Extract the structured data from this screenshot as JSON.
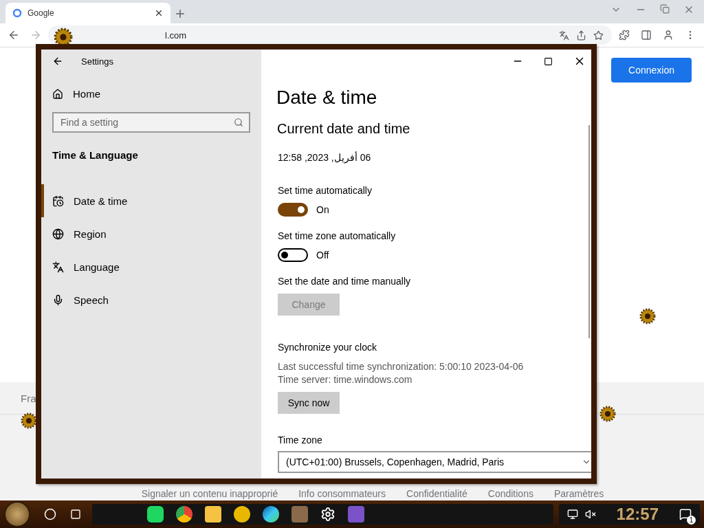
{
  "browser": {
    "tab": {
      "title": "Google"
    },
    "address": "l.com",
    "page": {
      "sign_in_button": "Connexion",
      "footer_language": "Fra",
      "footer_links": [
        "Signaler un contenu inapproprié",
        "Info consommateurs",
        "Confidentialité",
        "Conditions",
        "Paramètres"
      ]
    }
  },
  "settings": {
    "title": "Settings",
    "nav": {
      "home": "Home",
      "search": {
        "placeholder": "Find a setting"
      },
      "section": "Time & Language",
      "items": [
        {
          "kind": "calendar",
          "label": "Date & time",
          "selected": true
        },
        {
          "kind": "globe",
          "label": "Region",
          "selected": false
        },
        {
          "kind": "language",
          "label": "Language",
          "selected": false
        },
        {
          "kind": "mic",
          "label": "Speech",
          "selected": false
        }
      ]
    },
    "content": {
      "title": "Date & time",
      "subtitle": "Current date and time",
      "current": "06 أفريل, 2023, 12:58",
      "toggles": [
        {
          "label": "Set time automatically",
          "on": true,
          "state_text": "On"
        },
        {
          "label": "Set time zone automatically",
          "on": false,
          "state_text": "Off"
        }
      ],
      "manual": {
        "label": "Set the date and time manually",
        "button": {
          "label": "Change",
          "disabled": true
        }
      },
      "sync": {
        "title": "Synchronize your clock",
        "last": "Last successful time synchronization: 5:00:10 2023-04-06",
        "server": "Time server: time.windows.com",
        "button": {
          "label": "Sync now",
          "disabled": false
        }
      },
      "timezone": {
        "label": "Time zone",
        "value": "(UTC+01:00) Brussels, Copenhagen, Madrid, Paris"
      }
    }
  },
  "taskbar": {
    "clock": "12:57",
    "notifications": "1"
  }
}
